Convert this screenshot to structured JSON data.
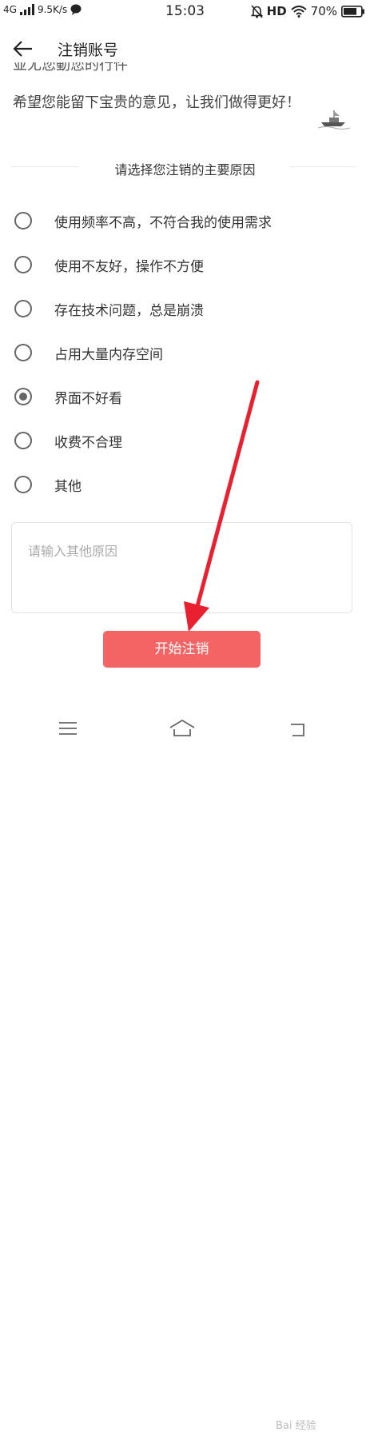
{
  "status_bar": {
    "network": "4G",
    "speed": "9.5K/s",
    "time": "15:03",
    "hd": "HD",
    "battery": "70%"
  },
  "header": {
    "title": "注销账号",
    "back_icon": "arrow-left-icon"
  },
  "intro": {
    "line1_partial": "並尤您動您的行件",
    "line2": "希望您能留下宝贵的意见，让我们做得更好！"
  },
  "section": {
    "title": "请选择您注销的主要原因"
  },
  "reasons": [
    {
      "label": "使用频率不高，不符合我的使用需求",
      "checked": false
    },
    {
      "label": "使用不友好，操作不方便",
      "checked": false
    },
    {
      "label": "存在技术问题，总是崩溃",
      "checked": false
    },
    {
      "label": "占用大量内存空间",
      "checked": false
    },
    {
      "label": "界面不好看",
      "checked": true
    },
    {
      "label": "收费不合理",
      "checked": false
    },
    {
      "label": "其他",
      "checked": false
    }
  ],
  "other_reason": {
    "placeholder": "请输入其他原因",
    "value": ""
  },
  "submit_button": {
    "label": "开始注销"
  },
  "bottom_nav": {
    "icons": [
      "menu-icon",
      "home-icon",
      "back-icon"
    ]
  },
  "watermark": "Bai 经验",
  "colors": {
    "accent": "#f56464",
    "annotation_arrow": "#e8202f"
  }
}
